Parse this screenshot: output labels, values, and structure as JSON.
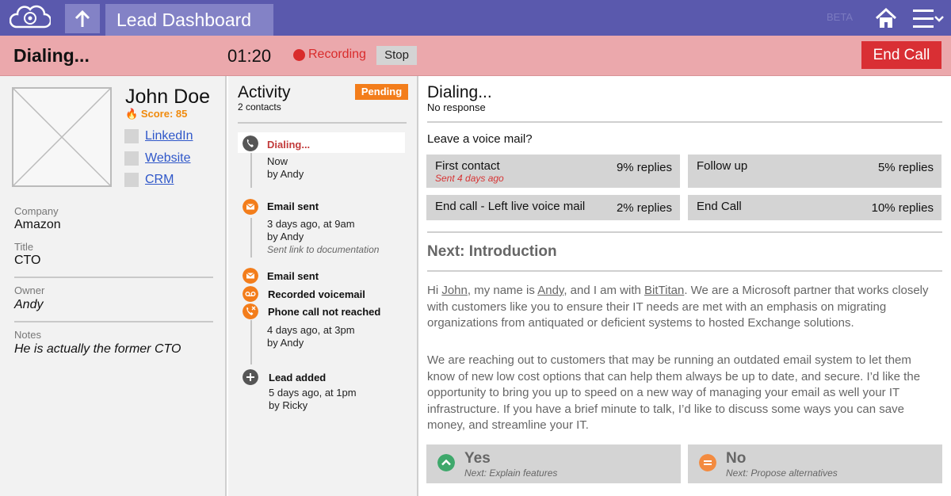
{
  "topbar": {
    "title": "Lead Dashboard",
    "beta": "BETA",
    "accent": "#5a59ad"
  },
  "callbar": {
    "status": "Dialing...",
    "timer": "01:20",
    "recording": "Recording",
    "stop": "Stop",
    "end_call": "End Call",
    "end_call_color": "#d92f34"
  },
  "lead": {
    "name": "John Doe",
    "score": "Score: 85",
    "links": [
      "LinkedIn",
      "Website",
      "CRM"
    ],
    "fields": [
      {
        "label": "Company",
        "value": "Amazon"
      },
      {
        "label": "Title",
        "value": "CTO"
      },
      {
        "label": "Owner",
        "value": "Andy"
      },
      {
        "label": "Notes",
        "value": "He is actually the former CTO"
      }
    ]
  },
  "activity": {
    "title": "Activity",
    "subtitle": "2 contacts",
    "badge": "Pending",
    "events": [
      {
        "head": "Dialing...",
        "lines": [
          "Now",
          "by Andy"
        ],
        "icon": "phone-icon"
      },
      {
        "head": "Email sent",
        "lines": [
          "3 days ago, at 9am",
          "by Andy"
        ],
        "note": "Sent link to documentation",
        "icon": "email-icon"
      },
      {
        "head": "Email sent",
        "icon": "email-icon"
      },
      {
        "head": "Recorded voicemail",
        "icon": "voicemail-icon"
      },
      {
        "head": "Phone call not reached",
        "lines": [
          "4 days ago, at 3pm",
          "by Andy"
        ],
        "icon": "phone-missed-icon"
      },
      {
        "head": "Lead added",
        "lines": [
          "5 days ago, at 1pm",
          "by Ricky"
        ],
        "icon": "plus-icon"
      }
    ]
  },
  "call_panel": {
    "title": "Dialing...",
    "subtitle": "No response",
    "vm_prompt": "Leave a voice mail?",
    "vm_options": [
      {
        "label": "First contact",
        "rate": "9% replies",
        "sent": "Sent 4 days ago"
      },
      {
        "label": "Follow up",
        "rate": "5% replies"
      },
      {
        "label": "End call - Left live voice mail",
        "rate": "2% replies"
      },
      {
        "label": "End Call",
        "rate": "10% replies"
      }
    ],
    "next_title": "Next: Introduction",
    "script": {
      "p1_a": "Hi ",
      "p1_name": "John",
      "p1_b": ", my name is ",
      "p1_agent": "Andy",
      "p1_c": ", and I am with ",
      "p1_company": "BitTitan",
      "p1_d": ". We are a Microsoft partner that works closely with customers like you to ensure their IT needs are met with an emphasis on migrating organizations from antiquated or deficient systems to hosted Exchange solutions.",
      "p2": "We are reaching out to customers that may be running an outdated email system to let them know of new low cost options that can help them always be up to date, and secure. I’d like the opportunity to bring you up to speed on a new way of managing your email as well your IT infrastructure. If you have a brief minute to talk, I’d like to discuss some ways you can save money, and streamline your IT."
    },
    "answers": [
      {
        "label": "Yes",
        "sub": "Next: Explain features",
        "color": "#3ea86b"
      },
      {
        "label": "No",
        "sub": "Next: Propose alternatives",
        "color": "#f38b40"
      }
    ]
  }
}
